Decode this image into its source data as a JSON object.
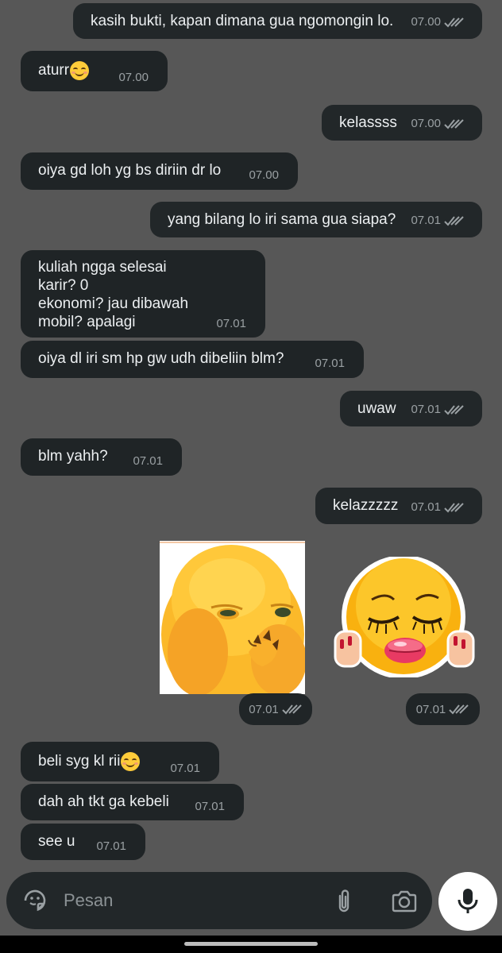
{
  "messages": [
    {
      "text": "kasih bukti, kapan dimana gua ngomongin lo.",
      "time": "07.00",
      "dir": "out"
    },
    {
      "text": "aturr",
      "time": "07.00",
      "dir": "in",
      "emoji": "smiling-face-emoji"
    },
    {
      "text": "kelassss",
      "time": "07.00",
      "dir": "out"
    },
    {
      "text": "oiya gd loh yg bs diriin dr lo",
      "time": "07.00",
      "dir": "in"
    },
    {
      "text": "yang bilang lo iri sama gua siapa?",
      "time": "07.01",
      "dir": "out"
    },
    {
      "text": "kuliah ngga selesai\nkarir? 0\nekonomi? jau dibawah\nmobil? apalagi",
      "time": "07.01",
      "dir": "in"
    },
    {
      "text": "oiya dl iri sm hp gw udh dibeliin blm?",
      "time": "07.01",
      "dir": "in"
    },
    {
      "text": "uwaw",
      "time": "07.01",
      "dir": "out"
    },
    {
      "text": "blm yahh?",
      "time": "07.01",
      "dir": "in"
    },
    {
      "text": "kelazzzzz",
      "time": "07.01",
      "dir": "out"
    },
    {
      "text": "beli syg kl rii",
      "time": "07.01",
      "dir": "in",
      "emoji": "smiling-face-emoji"
    },
    {
      "text": "dah ah tkt ga kebeli",
      "time": "07.01",
      "dir": "in"
    },
    {
      "text": "see u",
      "time": "07.01",
      "dir": "in"
    }
  ],
  "stickers": [
    {
      "name": "yellow-creature-sticker",
      "time": "07.01"
    },
    {
      "name": "pleading-kiss-emoji-sticker",
      "time": "07.01"
    }
  ],
  "composer": {
    "placeholder": "Pesan",
    "icons": [
      "sticker-icon",
      "attach-icon",
      "camera-icon",
      "mic-icon"
    ]
  },
  "colors": {
    "background": "#575757",
    "bubble": "#1f2426",
    "text": "#eceff1",
    "meta": "#9aa0a3"
  }
}
